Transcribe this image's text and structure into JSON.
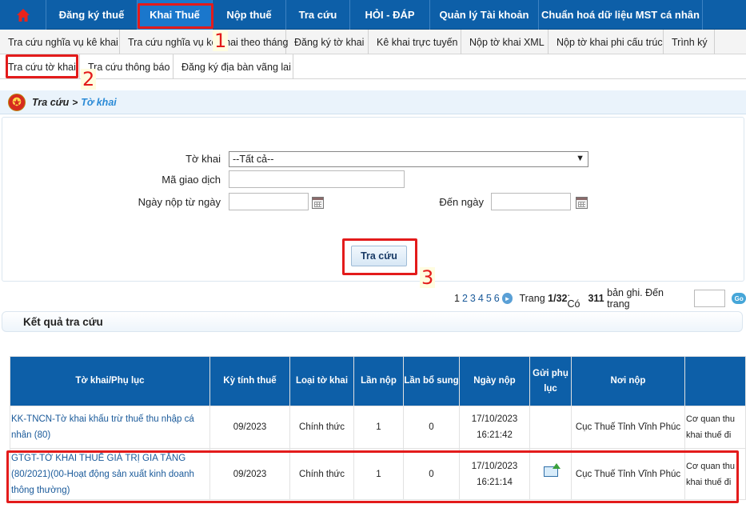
{
  "topnav": {
    "items": [
      {
        "label": "Đăng ký thuế"
      },
      {
        "label": "Khai Thuế"
      },
      {
        "label": "Nộp thuế"
      },
      {
        "label": "Tra cứu"
      },
      {
        "label": "HỎI - ĐÁP"
      },
      {
        "label": "Quản lý Tài khoản"
      },
      {
        "label": "Chuẩn hoá dữ liệu MST cá nhân"
      }
    ]
  },
  "subnav": {
    "row1": [
      "Tra cứu nghĩa vụ kê khai",
      "Tra cứu nghĩa vụ kê khai theo tháng",
      "Đăng ký tờ khai",
      "Kê khai trực tuyến",
      "Nộp tờ khai XML",
      "Nộp tờ khai phi cấu trúc",
      "Trình ký"
    ],
    "row2": [
      "Tra cứu tờ khai",
      "Tra cứu thông báo",
      "Đăng ký địa bàn vãng lai"
    ]
  },
  "breadcrumb": {
    "root": "Tra cứu",
    "sep": ">",
    "current": "Tờ khai"
  },
  "form": {
    "tokhai_label": "Tờ khai",
    "tokhai_value": "--Tất cả--",
    "magiaodich_label": "Mã giao dịch",
    "ngaynop_label": "Ngày nộp từ ngày",
    "denngay_label": "Đến ngày",
    "search_button": "Tra cứu"
  },
  "pagination": {
    "pages": [
      "1",
      "2",
      "3",
      "4",
      "5",
      "6"
    ],
    "trang_prefix": "Trang",
    "trang_value": "1/32",
    "co_prefix": ". Có",
    "total": "311",
    "suffix": "bản ghi. Đến trang",
    "go": "Go"
  },
  "results": {
    "title": "Kết quả tra cứu",
    "columns": [
      "Tờ khai/Phụ lục",
      "Kỳ tính thuế",
      "Loại tờ khai",
      "Lần nộp",
      "Lần bổ sung",
      "Ngày nộp",
      "Gửi phụ lục",
      "Nơi nộp",
      ""
    ],
    "rows": [
      {
        "name": "KK-TNCN-Tờ khai khấu trừ thuế thu nhập cá nhân (80)",
        "period": "09/2023",
        "type": "Chính thức",
        "submit": "1",
        "supplement": "0",
        "date": "17/10/2023",
        "time": "16:21:42",
        "place": "Cục Thuế Tỉnh Vĩnh Phúc",
        "agency_line1": "Cơ quan thu",
        "agency_line2": "khai thuế đi"
      },
      {
        "name": "GTGT-TỜ KHAI THUẾ GIÁ TRỊ GIA TĂNG (80/2021)(00-Hoạt động sản xuất kinh doanh thông thường)",
        "period": "09/2023",
        "type": "Chính thức",
        "submit": "1",
        "supplement": "0",
        "date": "17/10/2023",
        "time": "16:21:14",
        "place": "Cục Thuế Tỉnh Vĩnh Phúc",
        "agency_line1": "Cơ quan thu",
        "agency_line2": "khai thuế đi"
      }
    ]
  },
  "annotations": [
    "1",
    "2",
    "3"
  ]
}
